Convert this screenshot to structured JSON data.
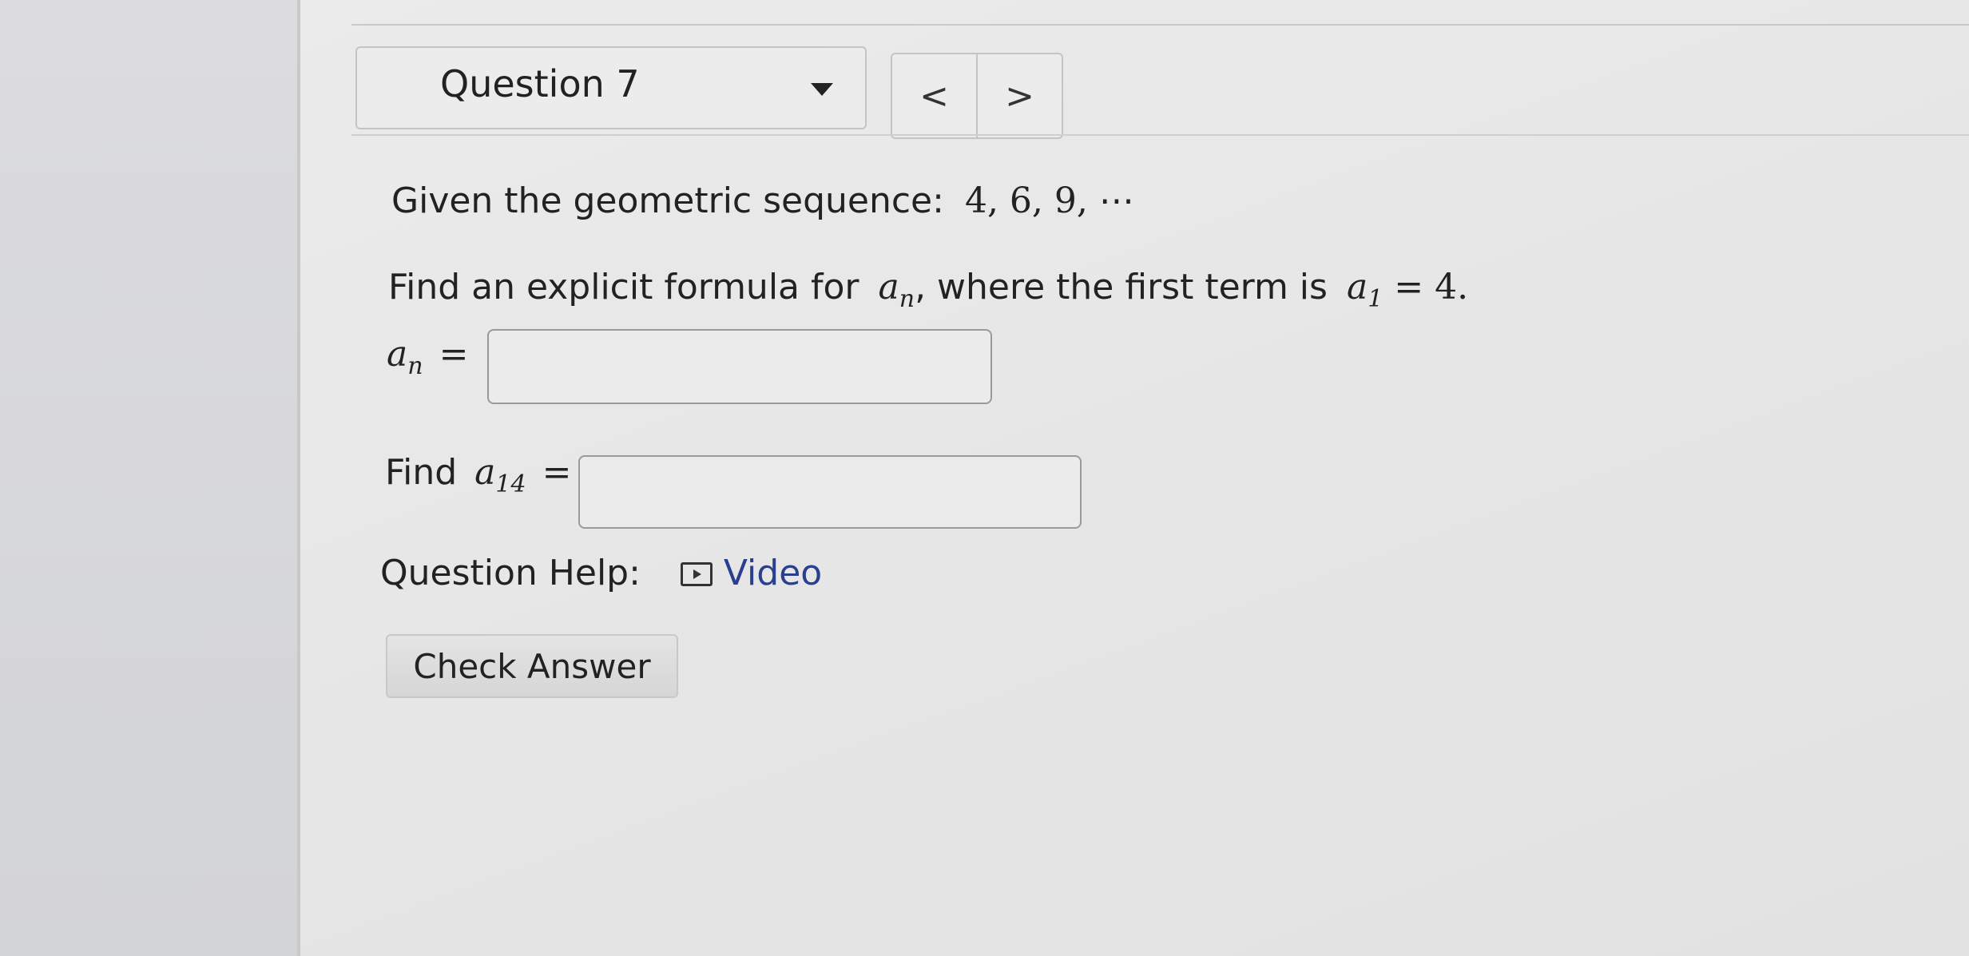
{
  "header": {
    "question_select_label": "Question 7",
    "prev_label": "<",
    "next_label": ">"
  },
  "problem": {
    "intro_text": "Given the geometric sequence:",
    "sequence_terms": "4, 6, 9, ⋯",
    "prompt_part1": "Find an explicit formula for",
    "prompt_var": "a",
    "prompt_var_sub": "n",
    "prompt_part2": ", where the first term is",
    "first_term_var": "a",
    "first_term_sub": "1",
    "first_term_eq": "= 4."
  },
  "answers": {
    "formula_label_var": "a",
    "formula_label_sub": "n",
    "formula_label_eq": "=",
    "formula_value": "",
    "term_label_text": "Find",
    "term_label_var": "a",
    "term_label_sub": "14",
    "term_label_eq": "=",
    "term_value": ""
  },
  "help": {
    "label": "Question Help:",
    "video_label": "Video",
    "video_icon": "play-video-icon"
  },
  "actions": {
    "check_answer_label": "Check Answer"
  }
}
